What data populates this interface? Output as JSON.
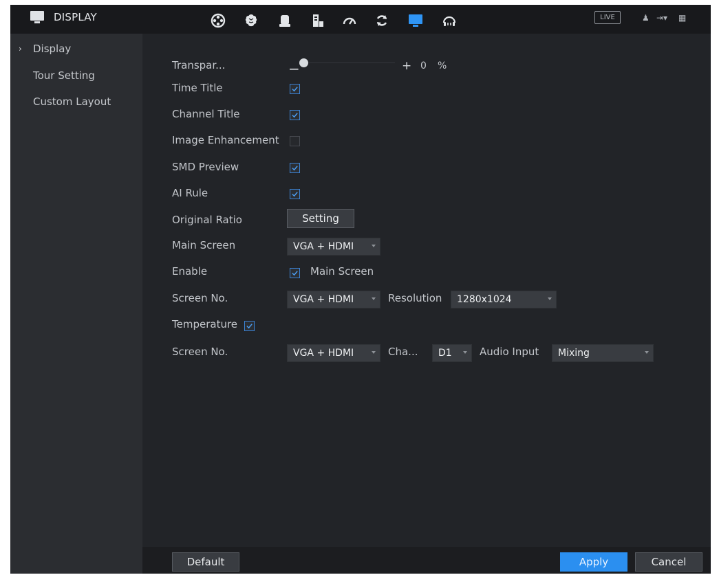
{
  "header": {
    "title": "DISPLAY",
    "nav_icons": [
      "view-icon",
      "brain-icon",
      "storage-icon",
      "server-icon",
      "speed-icon",
      "refresh-icon",
      "display-icon",
      "headset-icon"
    ],
    "live_label": "LIVE"
  },
  "sidebar": {
    "items": [
      {
        "label": "Display",
        "selected": true
      },
      {
        "label": "Tour Setting",
        "selected": false
      },
      {
        "label": "Custom Layout",
        "selected": false
      }
    ]
  },
  "form": {
    "transparency": {
      "label": "Transpar...",
      "minus": "−",
      "plus": "+",
      "value": "0",
      "unit": "%"
    },
    "time_title": {
      "label": "Time Title",
      "checked": true
    },
    "channel_title": {
      "label": "Channel Title",
      "checked": true
    },
    "image_enhancement": {
      "label": "Image Enhancement",
      "checked": false
    },
    "smd_preview": {
      "label": "SMD Preview",
      "checked": true
    },
    "ai_rule": {
      "label": "AI Rule",
      "checked": true
    },
    "original_ratio": {
      "label": "Original Ratio",
      "button": "Setting"
    },
    "main_screen": {
      "label": "Main Screen",
      "value": "VGA + HDMI"
    },
    "enable": {
      "label": "Enable",
      "checked": true,
      "option": "Main Screen"
    },
    "screen_no_1": {
      "label": "Screen No.",
      "value": "VGA + HDMI",
      "resolution_label": "Resolution",
      "resolution_value": "1280x1024"
    },
    "temperature": {
      "label": "Temperature",
      "checked": true
    },
    "screen_no_2": {
      "label": "Screen No.",
      "value": "VGA + HDMI",
      "channel_label": "Cha...",
      "channel_value": "D1",
      "audio_label": "Audio Input",
      "audio_value": "Mixing"
    }
  },
  "footer": {
    "default_label": "Default",
    "apply_label": "Apply",
    "cancel_label": "Cancel"
  },
  "colors": {
    "background": "#222428",
    "sidebar": "#2b2d31",
    "topbar": "#18191c",
    "accent": "#2b8ff0",
    "checkbox_border": "#3b83d6"
  }
}
